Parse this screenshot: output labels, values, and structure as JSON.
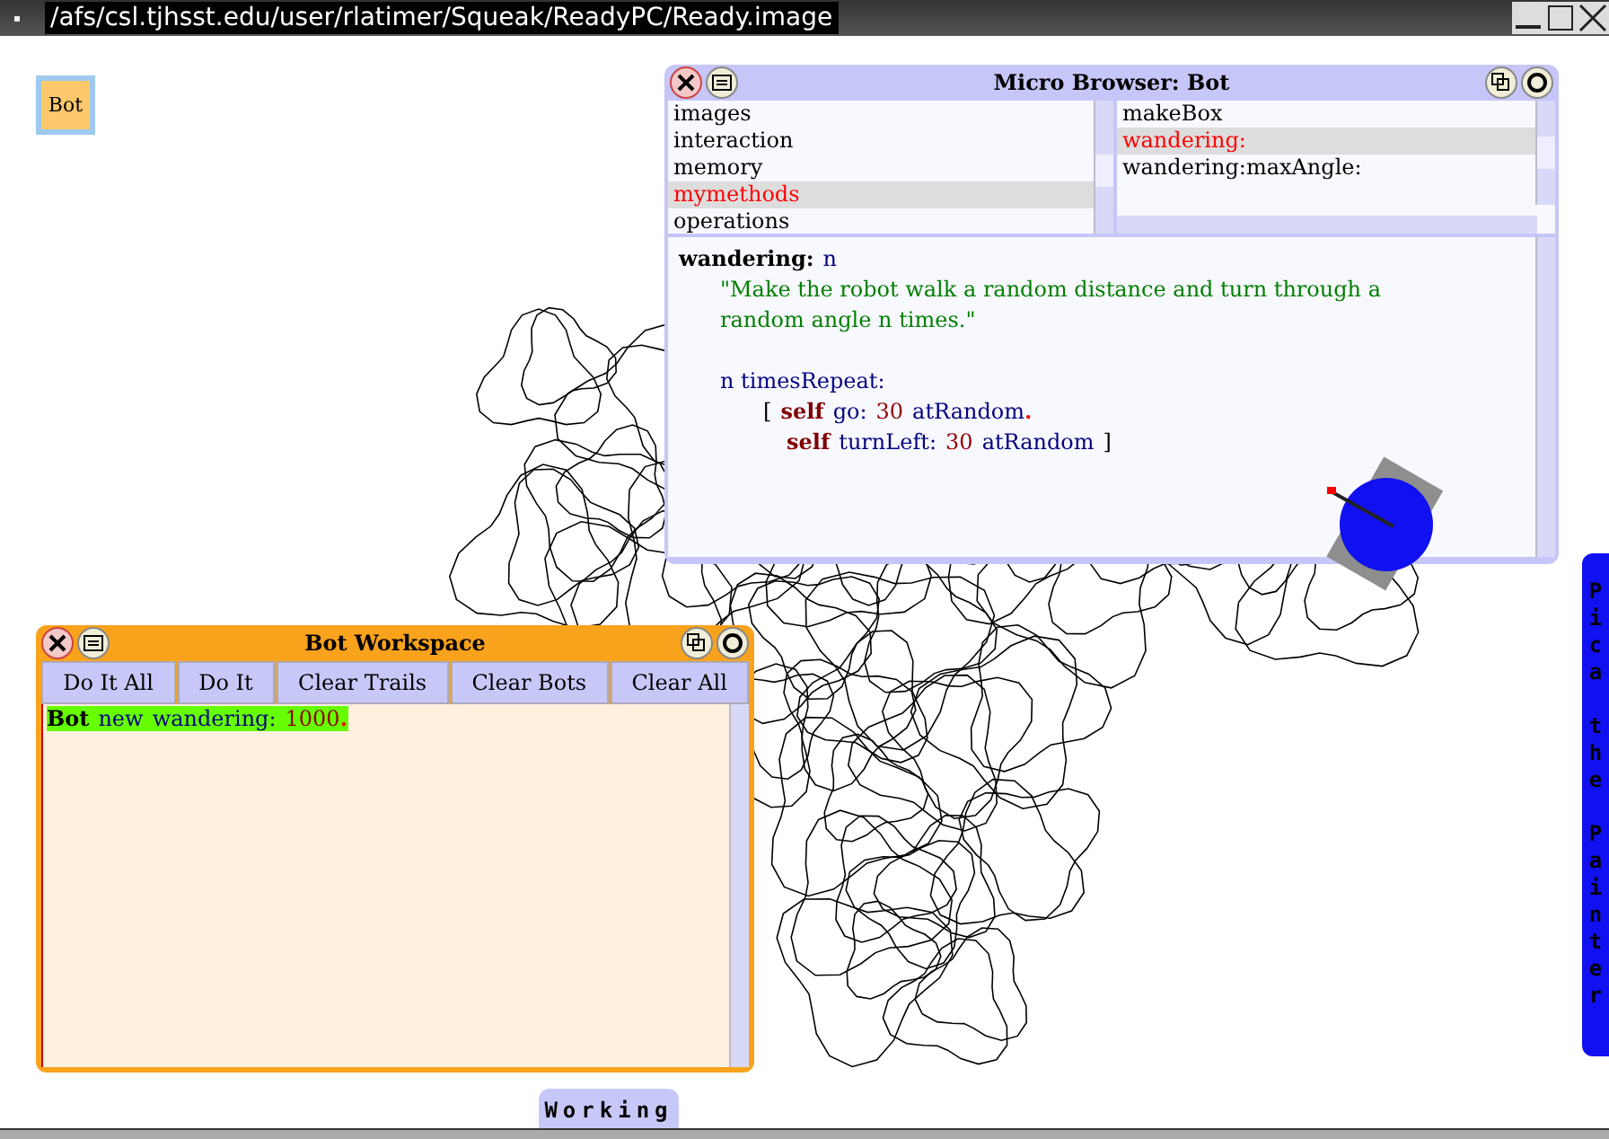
{
  "window": {
    "title": "/afs/csl.tjhsst.edu/user/rlatimer/Squeak/ReadyPC/Ready.image"
  },
  "bot_button": {
    "label": "Bot"
  },
  "browser": {
    "title": "Micro Browser: Bot",
    "categories": [
      {
        "label": "images",
        "selected": false
      },
      {
        "label": "interaction",
        "selected": false
      },
      {
        "label": "memory",
        "selected": false
      },
      {
        "label": "mymethods",
        "selected": true
      },
      {
        "label": "operations",
        "selected": false
      }
    ],
    "methods": [
      {
        "label": "makeBox",
        "selected": false
      },
      {
        "label": "wandering:",
        "selected": true
      },
      {
        "label": "wandering:maxAngle:",
        "selected": false
      }
    ],
    "code": [
      {
        "kind": "header",
        "tokens": [
          {
            "kind": "method",
            "text": "wandering:"
          },
          {
            "kind": "name",
            "text": "n"
          }
        ]
      },
      {
        "kind": "comment",
        "tokens": [
          {
            "kind": "comment",
            "text": "\"Make the robot walk a random distance and turn through a"
          }
        ]
      },
      {
        "kind": "comment",
        "tokens": [
          {
            "kind": "comment",
            "text": "random angle n times.\""
          }
        ]
      },
      {
        "kind": "blank"
      },
      {
        "kind": "body",
        "tokens": [
          {
            "kind": "name",
            "text": "n timesRepeat:"
          }
        ]
      },
      {
        "kind": "block",
        "tokens": [
          {
            "kind": "plain",
            "text": "["
          },
          {
            "kind": "self",
            "text": "self"
          },
          {
            "kind": "name",
            "text": "go:"
          },
          {
            "kind": "number",
            "text": "30"
          },
          {
            "kind": "name",
            "text": "atRandom"
          },
          {
            "kind": "period",
            "text": "."
          }
        ]
      },
      {
        "kind": "inner",
        "tokens": [
          {
            "kind": "self",
            "text": "self"
          },
          {
            "kind": "name",
            "text": "turnLeft:"
          },
          {
            "kind": "number",
            "text": "30"
          },
          {
            "kind": "name",
            "text": "atRandom"
          },
          {
            "kind": "plain",
            "text": "]"
          }
        ]
      }
    ]
  },
  "workspace": {
    "title": "Bot Workspace",
    "buttons": [
      "Do It All",
      "Do It",
      "Clear Trails",
      "Clear Bots",
      "Clear All"
    ],
    "tokens": [
      {
        "kind": "method",
        "text": "Bot"
      },
      {
        "kind": "name",
        "text": "new"
      },
      {
        "kind": "name",
        "text": "wandering:"
      },
      {
        "kind": "number",
        "text": "1000"
      },
      {
        "kind": "period",
        "text": "."
      }
    ]
  },
  "side_tab": {
    "label": "Pica  the  Painter"
  },
  "status_tab": {
    "label": "Working"
  }
}
